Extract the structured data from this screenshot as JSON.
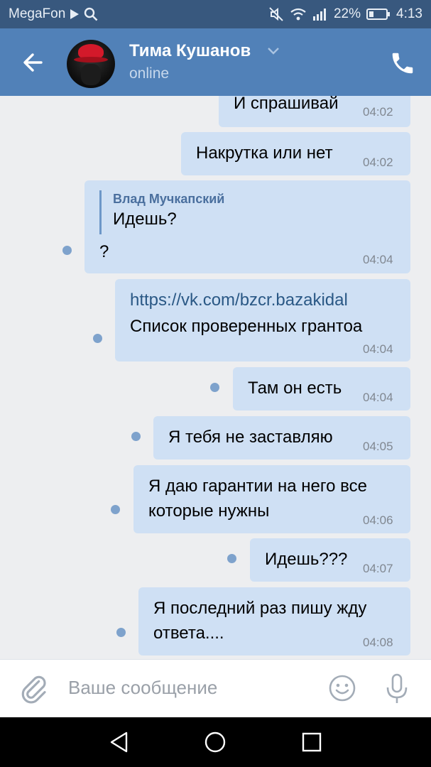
{
  "status_bar": {
    "carrier": "MegaFon",
    "battery": "22%",
    "time": "4:13"
  },
  "header": {
    "contact_name": "Тима Кушанов",
    "contact_status": "online"
  },
  "messages": [
    {
      "text": "И спрашивай",
      "time": "04:02"
    },
    {
      "text": "Накрутка или нет",
      "time": "04:02"
    },
    {
      "reply_author": "Влад Мучкапский",
      "reply_text": "Идешь?",
      "text": "?",
      "time": "04:04"
    },
    {
      "link": "https://vk.com/bzcr.bazakidal",
      "text": "Список проверенных грантоа",
      "time": "04:04"
    },
    {
      "text": "Там он есть",
      "time": "04:04"
    },
    {
      "text": "Я тебя не заставляю",
      "time": "04:05"
    },
    {
      "line1": "Я даю гарантии на него все",
      "line2": "которые нужны",
      "time": "04:06"
    },
    {
      "text": "Идешь???",
      "time": "04:07"
    },
    {
      "line1": "Я последний раз пишу жду",
      "line2": "ответа....",
      "time": "04:08"
    }
  ],
  "input": {
    "placeholder": "Ваше сообщение"
  },
  "icons": {
    "back": "arrow-left-icon",
    "call": "phone-icon",
    "attach": "paperclip-icon",
    "emoji": "smiley-icon",
    "mic": "microphone-icon",
    "nav_back": "triangle-back-icon",
    "nav_home": "circle-home-icon",
    "nav_recents": "square-recents-icon"
  },
  "colors": {
    "status_bar": "#38587e",
    "header": "#5181b8",
    "bubble": "#cfe0f4",
    "background": "#edeef0",
    "unread_dot": "#7ea2cc"
  }
}
